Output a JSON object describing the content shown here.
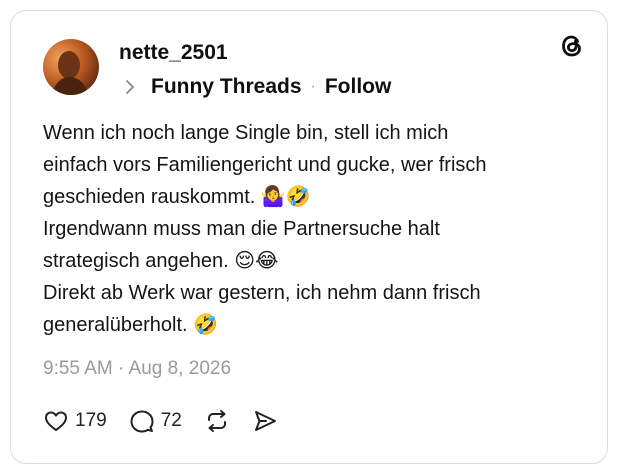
{
  "post": {
    "username": "nette_2501",
    "community": "Funny Threads",
    "follow_label": "Follow",
    "separator": "·",
    "body_lines": [
      "Wenn ich noch lange Single bin, stell ich mich",
      "einfach vors Familiengericht und gucke, wer frisch",
      "geschieden rauskommt. 🤷‍♀️🤣",
      "Irgendwann muss man die Partnersuche halt",
      "strategisch angehen. 😌😂",
      "Direkt ab Werk war gestern, ich nehm dann frisch",
      "generalüberholt. 🤣"
    ],
    "timestamp": "9:55 AM · Aug 8, 2026",
    "likes": "179",
    "replies": "72"
  },
  "icons": {
    "logo": "threads-logo-icon",
    "chevron": "chevron-right-icon",
    "like": "heart-icon",
    "reply": "comment-bubble-icon",
    "repost": "repost-icon",
    "share": "send-icon"
  }
}
